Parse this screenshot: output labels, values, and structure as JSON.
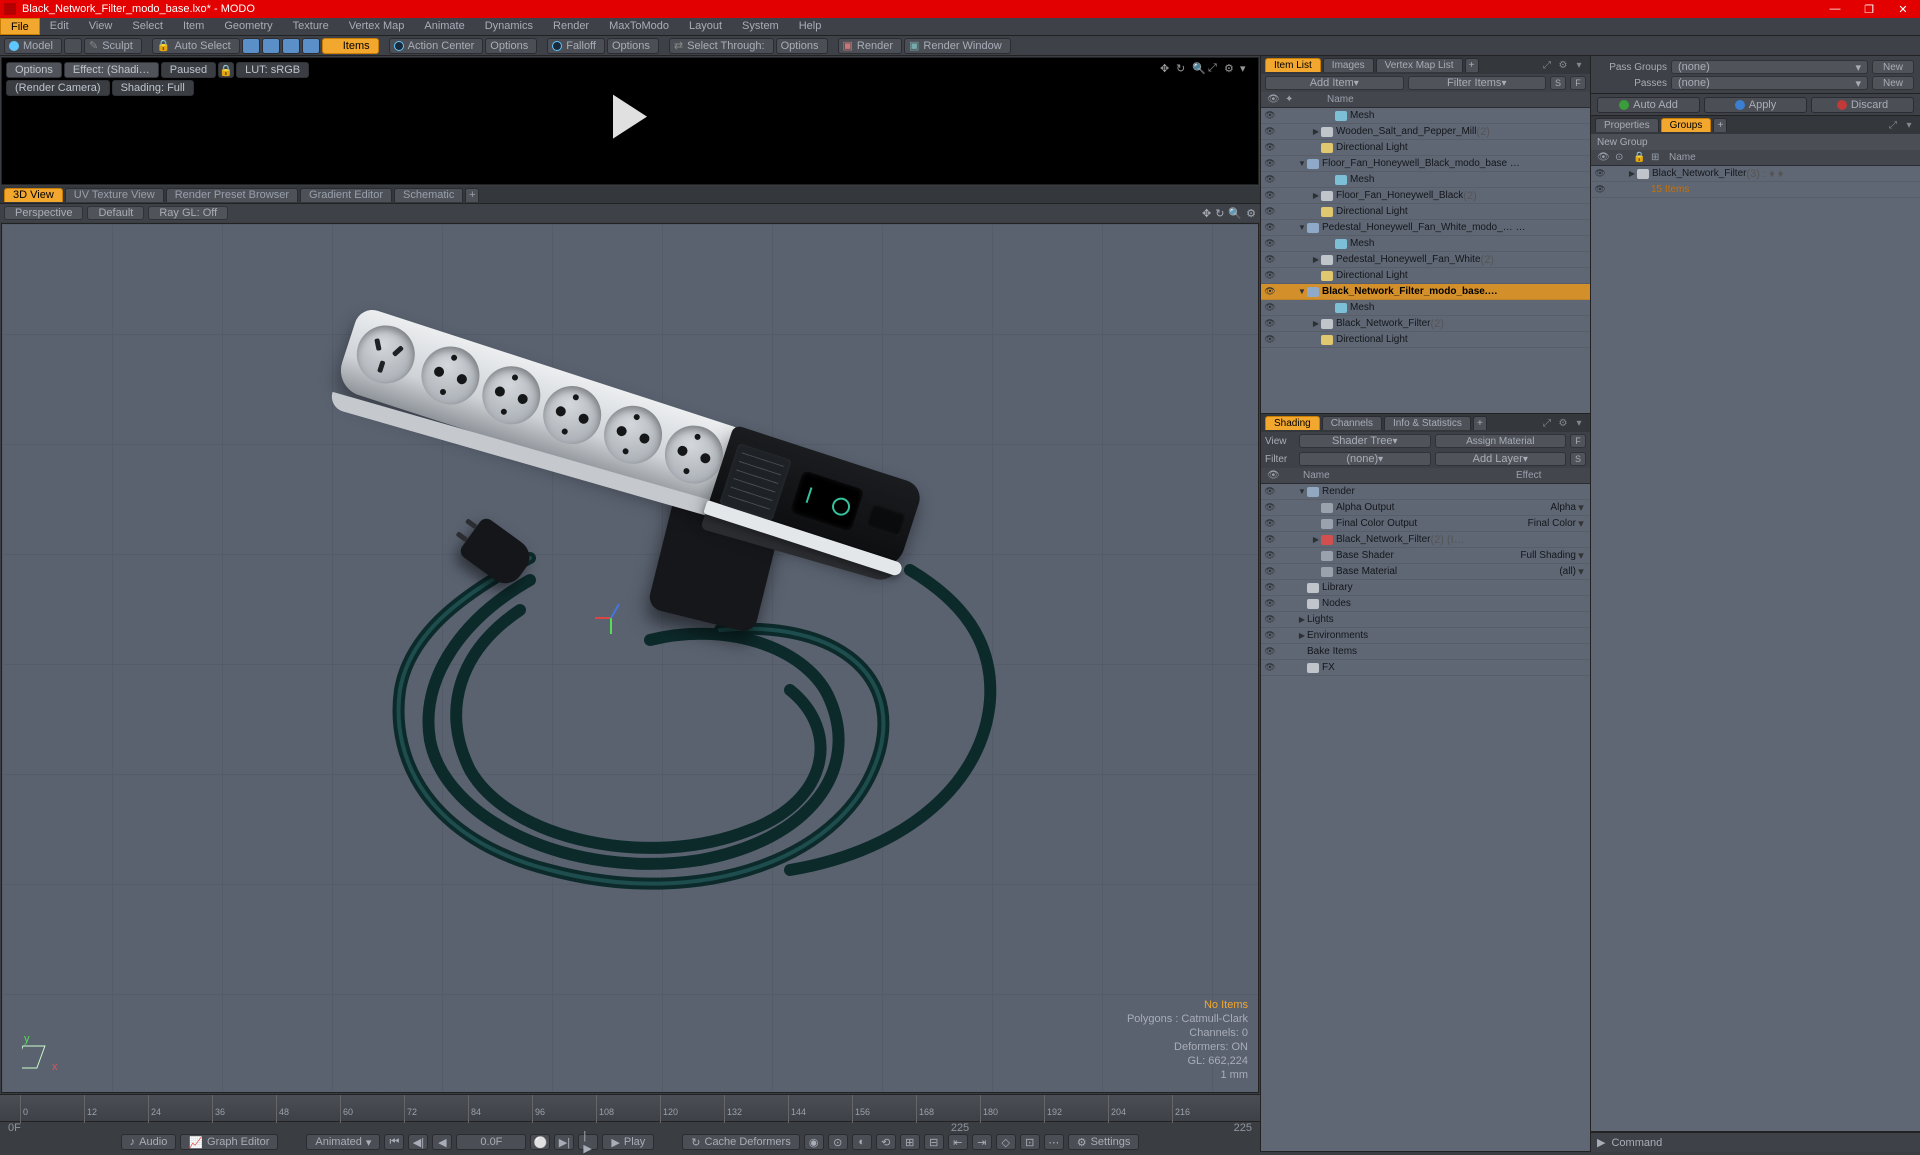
{
  "app": {
    "title": "Black_Network_Filter_modo_base.lxo* - MODO"
  },
  "menus": [
    "File",
    "Edit",
    "View",
    "Select",
    "Item",
    "Geometry",
    "Texture",
    "Vertex Map",
    "Animate",
    "Dynamics",
    "Render",
    "MaxToModo",
    "Layout",
    "System",
    "Help"
  ],
  "toolbar": {
    "model": "Model",
    "sculpt": "Sculpt",
    "autoSelect": "Auto Select",
    "items": "Items",
    "actionCenter": "Action Center",
    "options": "Options",
    "falloff": "Falloff",
    "options2": "Options",
    "selectThrough": "Select Through:",
    "options3": "Options",
    "render": "Render",
    "renderWindow": "Render Window"
  },
  "preview": {
    "options": "Options",
    "effect": "Effect: (Shadi…",
    "paused": "Paused",
    "lut": "LUT: sRGB",
    "camera": "(Render Camera)",
    "shading": "Shading: Full"
  },
  "viewTabs": [
    "3D View",
    "UV Texture View",
    "Render Preset Browser",
    "Gradient Editor",
    "Schematic"
  ],
  "vsub": {
    "persp": "Perspective",
    "default": "Default",
    "raygl": "Ray GL: Off"
  },
  "vpStats": {
    "noItems": "No Items",
    "poly": "Polygons : Catmull-Clark",
    "channels": "Channels: 0",
    "deformers": "Deformers: ON",
    "gl": "GL: 662,224",
    "unit": "1 mm"
  },
  "timeline": {
    "ticks": [
      0,
      12,
      24,
      36,
      48,
      60,
      72,
      84,
      96,
      108,
      120,
      132,
      144,
      156,
      168,
      180,
      192,
      204,
      216
    ],
    "rangeLeft": "0F",
    "rangeRight": "225",
    "audio": "Audio",
    "graph": "Graph Editor",
    "mode": "Animated",
    "frame": "0.0F",
    "play": "Play",
    "cache": "Cache Deformers",
    "settings": "Settings"
  },
  "itemList": {
    "tabs": [
      "Item List",
      "Images",
      "Vertex Map List"
    ],
    "addItem": "Add Item",
    "filterItems": "Filter Items",
    "headerName": "Name",
    "rows": [
      {
        "indent": 2,
        "arrow": "",
        "icon": "ic-mesh",
        "label": "Mesh",
        "dim": ""
      },
      {
        "indent": 1,
        "arrow": "▶",
        "icon": "ic-item",
        "label": "Wooden_Salt_and_Pepper_Mill",
        "dim": " (2)"
      },
      {
        "indent": 1,
        "arrow": "",
        "icon": "ic-light",
        "label": "Directional Light",
        "dim": ""
      },
      {
        "indent": 0,
        "arrow": "▼",
        "icon": "ic-group",
        "label": "Floor_Fan_Honeywell_Black_modo_base …",
        "dim": ""
      },
      {
        "indent": 2,
        "arrow": "",
        "icon": "ic-mesh",
        "label": "Mesh",
        "dim": ""
      },
      {
        "indent": 1,
        "arrow": "▶",
        "icon": "ic-item",
        "label": "Floor_Fan_Honeywell_Black",
        "dim": " (2)"
      },
      {
        "indent": 1,
        "arrow": "",
        "icon": "ic-light",
        "label": "Directional Light",
        "dim": ""
      },
      {
        "indent": 0,
        "arrow": "▼",
        "icon": "ic-group",
        "label": "Pedestal_Honeywell_Fan_White_modo_… …",
        "dim": ""
      },
      {
        "indent": 2,
        "arrow": "",
        "icon": "ic-mesh",
        "label": "Mesh",
        "dim": ""
      },
      {
        "indent": 1,
        "arrow": "▶",
        "icon": "ic-item",
        "label": "Pedestal_Honeywell_Fan_White",
        "dim": " (2)"
      },
      {
        "indent": 1,
        "arrow": "",
        "icon": "ic-light",
        "label": "Directional Light",
        "dim": ""
      },
      {
        "indent": 0,
        "arrow": "▼",
        "icon": "ic-group",
        "label": "Black_Network_Filter_modo_base.…",
        "dim": "",
        "sel": true
      },
      {
        "indent": 2,
        "arrow": "",
        "icon": "ic-mesh",
        "label": "Mesh",
        "dim": ""
      },
      {
        "indent": 1,
        "arrow": "▶",
        "icon": "ic-item",
        "label": "Black_Network_Filter",
        "dim": " (2)"
      },
      {
        "indent": 1,
        "arrow": "",
        "icon": "ic-light",
        "label": "Directional Light",
        "dim": ""
      }
    ]
  },
  "shading": {
    "tabs": [
      "Shading",
      "Channels",
      "Info & Statistics"
    ],
    "view": "View",
    "shaderTree": "Shader Tree",
    "assign": "Assign Material",
    "filter": "Filter",
    "none": "(none)",
    "addLayer": "Add Layer",
    "headName": "Name",
    "headEffect": "Effect",
    "rows": [
      {
        "indent": 0,
        "arrow": "▼",
        "icon": "ic-render",
        "label": "Render",
        "eff": ""
      },
      {
        "indent": 1,
        "arrow": "",
        "icon": "ic-mat",
        "label": "Alpha Output",
        "eff": "Alpha"
      },
      {
        "indent": 1,
        "arrow": "",
        "icon": "ic-mat",
        "label": "Final Color Output",
        "eff": "Final Color"
      },
      {
        "indent": 1,
        "arrow": "▶",
        "icon": "ic-red",
        "label": "Black_Network_Filter",
        "eff": "",
        "dim": " (2) (I…"
      },
      {
        "indent": 1,
        "arrow": "",
        "icon": "ic-mat",
        "label": "Base Shader",
        "eff": "Full Shading"
      },
      {
        "indent": 1,
        "arrow": "",
        "icon": "ic-mat",
        "label": "Base Material",
        "eff": "(all)"
      },
      {
        "indent": 0,
        "arrow": "",
        "icon": "ic-item",
        "label": "Library",
        "eff": ""
      },
      {
        "indent": 0,
        "arrow": "",
        "icon": "ic-item",
        "label": "Nodes",
        "eff": ""
      },
      {
        "indent": 0,
        "arrow": "▶",
        "icon": "",
        "label": "Lights",
        "eff": ""
      },
      {
        "indent": 0,
        "arrow": "▶",
        "icon": "",
        "label": "Environments",
        "eff": ""
      },
      {
        "indent": 0,
        "arrow": "",
        "icon": "",
        "label": "Bake Items",
        "eff": ""
      },
      {
        "indent": 0,
        "arrow": "",
        "icon": "ic-item",
        "label": "FX",
        "eff": ""
      }
    ]
  },
  "passGroups": {
    "label1": "Pass Groups",
    "label2": "Passes",
    "none": "(none)",
    "new": "New"
  },
  "actions": {
    "auto": "Auto Add",
    "apply": "Apply",
    "discard": "Discard"
  },
  "groups": {
    "tabs": [
      "Properties",
      "Groups"
    ],
    "newGroup": "New Group",
    "headerName": "Name",
    "rows": [
      {
        "indent": 0,
        "arrow": "▶",
        "icon": "ic-item",
        "label": "Black_Network_Filter",
        "dim": " (3) : ♦ ♦"
      },
      {
        "indent": 1,
        "arrow": "",
        "icon": "",
        "label": "15 Items",
        "dim": "",
        "style": "orange"
      }
    ]
  },
  "cmd": "Command"
}
